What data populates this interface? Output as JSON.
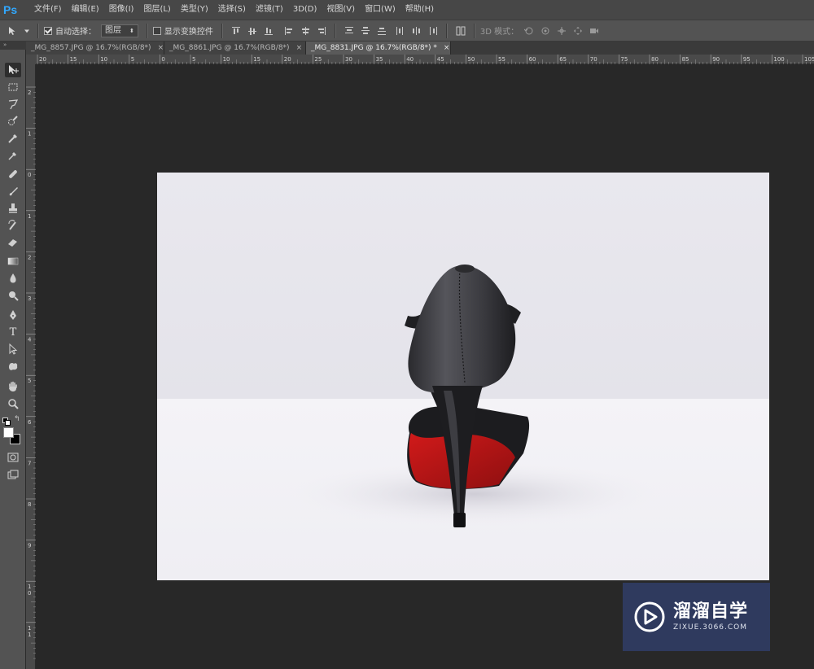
{
  "app": {
    "logo": "Ps",
    "brand_color": "#31a8ff"
  },
  "menu": [
    "文件(F)",
    "编辑(E)",
    "图像(I)",
    "图层(L)",
    "类型(Y)",
    "选择(S)",
    "滤镜(T)",
    "3D(D)",
    "视图(V)",
    "窗口(W)",
    "帮助(H)"
  ],
  "options": {
    "auto_select_label": "自动选择：",
    "auto_select_checked": true,
    "layer_select_value": "图层",
    "show_transform_label": "显示变换控件",
    "show_transform_checked": false,
    "mode_3d_label": "3D 模式："
  },
  "tabs": [
    {
      "title": "_MG_8857.JPG @ 16.7%(RGB/8*)",
      "close": "×",
      "active": false
    },
    {
      "title": "_MG_8861.JPG @ 16.7%(RGB/8*)",
      "close": "×",
      "active": false
    },
    {
      "title": "_MG_8831.JPG @ 16.7%(RGB/8*) *",
      "close": "×",
      "active": true
    }
  ],
  "hruler_labels": [
    "20",
    "15",
    "10",
    "5",
    "0",
    "5",
    "10",
    "15",
    "20",
    "25",
    "30",
    "35",
    "40",
    "45",
    "50",
    "55",
    "60",
    "65",
    "70",
    "75",
    "80",
    "85",
    "90",
    "95",
    "100",
    "105"
  ],
  "vruler_labels": [
    "2",
    "1",
    "0",
    "1",
    "2",
    "3",
    "4",
    "5",
    "6",
    "7",
    "8",
    "9",
    "10",
    "11"
  ],
  "tools": [
    "move-tool-icon",
    "marquee-tool-icon",
    "lasso-tool-icon",
    "quick-select-tool-icon",
    "eyedropper-tool-icon",
    "color-sampler-icon",
    "healing-brush-icon",
    "brush-tool-icon",
    "clone-stamp-icon",
    "history-brush-icon",
    "eraser-tool-icon",
    "gradient-tool-icon",
    "blur-tool-icon",
    "dodge-tool-icon",
    "pen-tool-icon",
    "type-tool-icon",
    "path-select-icon",
    "shape-tool-icon",
    "hand-tool-icon",
    "zoom-tool-icon"
  ],
  "type_tool_glyph": "T",
  "colors": {
    "foreground": "#ffffff",
    "background": "#000000"
  },
  "watermark": {
    "title": "溜溜自学",
    "url": "ZIXUE.3066.COM"
  }
}
